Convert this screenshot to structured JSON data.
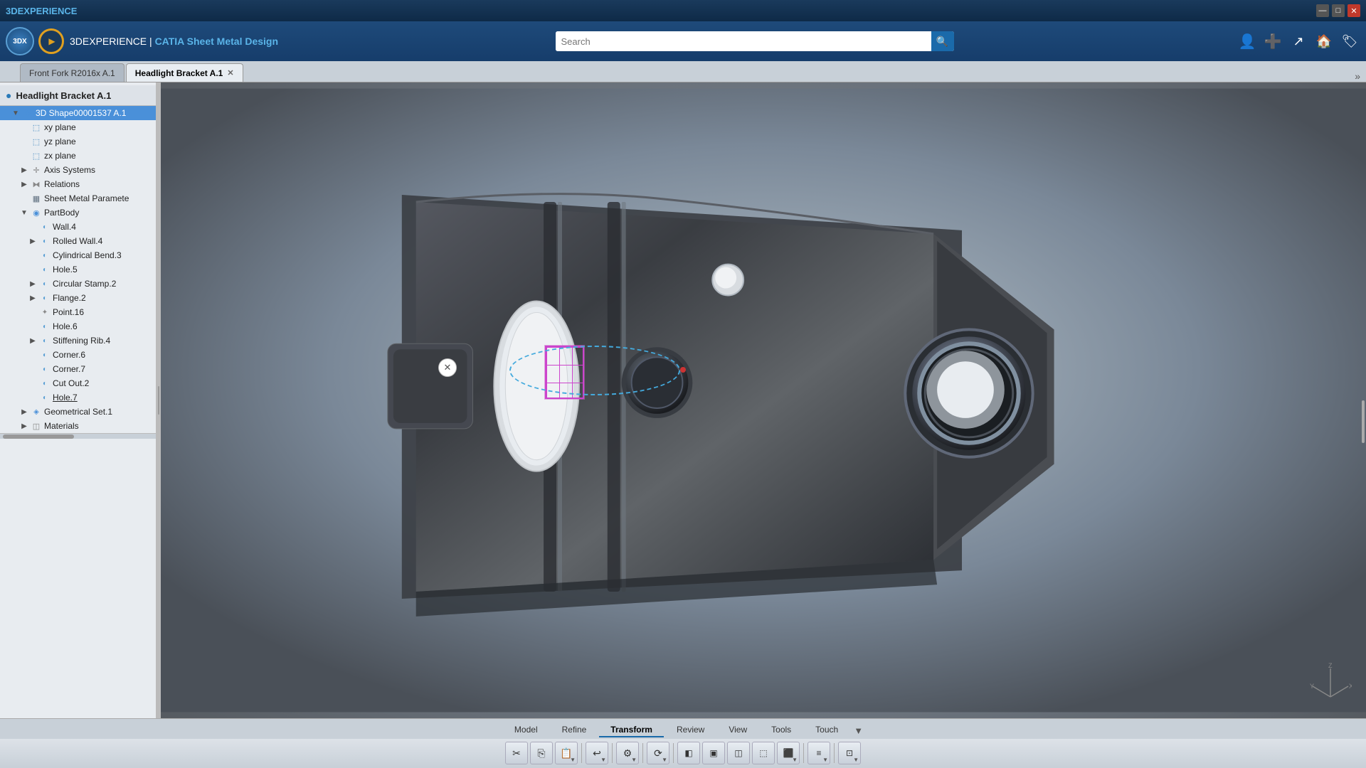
{
  "window": {
    "title": "3DEXPERIENCE",
    "app_title": "3DEXPERIENCE | CATIA Sheet Metal Design",
    "catia_label": "CATIA",
    "app_label": "Sheet Metal Design"
  },
  "titlebar_controls": [
    "—",
    "□",
    "✕"
  ],
  "tabs": [
    {
      "id": "tab1",
      "label": "Front Fork R2016x A.1",
      "active": false,
      "closable": false
    },
    {
      "id": "tab2",
      "label": "Headlight Bracket A.1",
      "active": true,
      "closable": true
    }
  ],
  "panel": {
    "title": "Headlight Bracket A.1",
    "tree": [
      {
        "level": 1,
        "label": "3D Shape00001537 A.1",
        "selected": true,
        "expandable": true,
        "icon": "shape"
      },
      {
        "level": 2,
        "label": "xy plane",
        "expandable": false,
        "icon": "plane"
      },
      {
        "level": 2,
        "label": "yz plane",
        "expandable": false,
        "icon": "plane"
      },
      {
        "level": 2,
        "label": "zx plane",
        "expandable": false,
        "icon": "plane"
      },
      {
        "level": 2,
        "label": "Axis Systems",
        "expandable": true,
        "icon": "axis"
      },
      {
        "level": 2,
        "label": "Relations",
        "expandable": true,
        "icon": "relations"
      },
      {
        "level": 2,
        "label": "Sheet Metal Paramete",
        "expandable": false,
        "icon": "params"
      },
      {
        "level": 2,
        "label": "PartBody",
        "expandable": true,
        "icon": "partbody"
      },
      {
        "level": 3,
        "label": "Wall.4",
        "expandable": false,
        "icon": "feature"
      },
      {
        "level": 3,
        "label": "Rolled Wall.4",
        "expandable": true,
        "icon": "feature"
      },
      {
        "level": 3,
        "label": "Cylindrical Bend.3",
        "expandable": false,
        "icon": "feature"
      },
      {
        "level": 3,
        "label": "Hole.5",
        "expandable": false,
        "icon": "feature"
      },
      {
        "level": 3,
        "label": "Circular Stamp.2",
        "expandable": true,
        "icon": "feature"
      },
      {
        "level": 3,
        "label": "Flange.2",
        "expandable": true,
        "icon": "feature"
      },
      {
        "level": 3,
        "label": "Point.16",
        "expandable": false,
        "icon": "point"
      },
      {
        "level": 3,
        "label": "Hole.6",
        "expandable": false,
        "icon": "feature"
      },
      {
        "level": 3,
        "label": "Stiffening Rib.4",
        "expandable": true,
        "icon": "feature"
      },
      {
        "level": 3,
        "label": "Corner.6",
        "expandable": false,
        "icon": "feature"
      },
      {
        "level": 3,
        "label": "Corner.7",
        "expandable": false,
        "icon": "feature"
      },
      {
        "level": 3,
        "label": "Cut Out.2",
        "expandable": false,
        "icon": "feature"
      },
      {
        "level": 3,
        "label": "Hole.7",
        "expandable": false,
        "icon": "feature"
      },
      {
        "level": 2,
        "label": "Geometrical Set.1",
        "expandable": true,
        "icon": "geoset"
      },
      {
        "level": 2,
        "label": "Materials",
        "expandable": true,
        "icon": "materials"
      }
    ]
  },
  "search": {
    "placeholder": "Search",
    "value": ""
  },
  "bottom_tabs": [
    "Model",
    "Refine",
    "Transform",
    "Review",
    "View",
    "Tools",
    "Touch"
  ],
  "active_bottom_tab": "Transform",
  "toolbar_icons": {
    "scissors": "✂",
    "copy": "⎘",
    "paste": "📋",
    "undo": "↩",
    "redo": "↪",
    "settings": "⚙",
    "view": "👁",
    "more": "▼"
  },
  "colors": {
    "accent_blue": "#1a6aaa",
    "selection_purple": "#cc44cc",
    "selection_blue": "#44aadd",
    "toolbar_bg": "#163d6b",
    "panel_bg": "#e8ecf0"
  }
}
